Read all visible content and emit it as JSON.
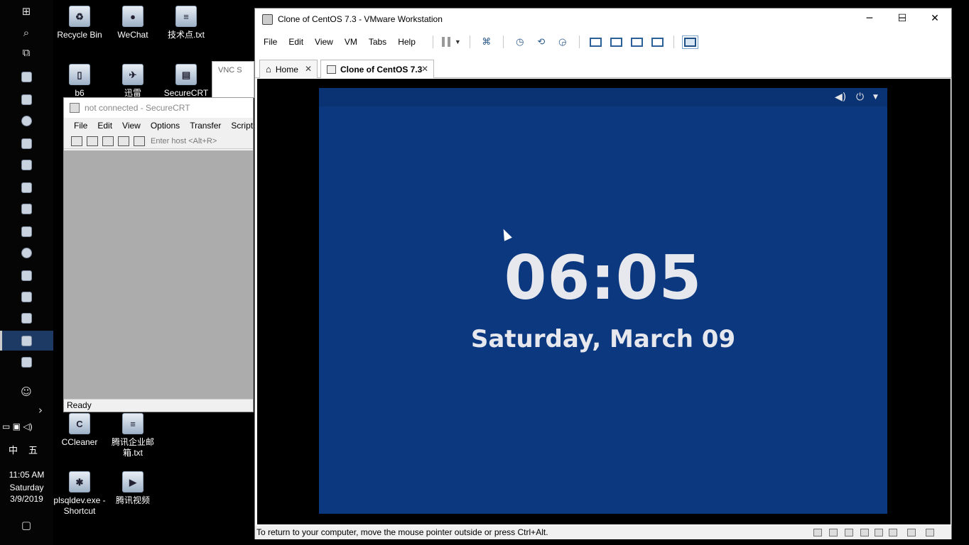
{
  "desktop": {
    "icons": [
      {
        "label": "Recycle Bin"
      },
      {
        "label": "WeChat"
      },
      {
        "label": "技术点.txt"
      },
      {
        "label": "b6"
      },
      {
        "label": "迅雷"
      },
      {
        "label": "SecureCRT"
      },
      {
        "label": "CCleaner"
      },
      {
        "label": "腾讯企业邮箱.txt"
      },
      {
        "label": "plsqldev.exe - Shortcut"
      },
      {
        "label": "腾讯视频"
      }
    ]
  },
  "taskbar": {
    "ime_lang": "中",
    "ime_mode": "五",
    "clock_time": "11:05 AM",
    "clock_day": "Saturday",
    "clock_date": "3/9/2019"
  },
  "securecrt": {
    "title": "not connected - SecureCRT",
    "menu": [
      "File",
      "Edit",
      "View",
      "Options",
      "Transfer",
      "Script"
    ],
    "enter_host": "Enter host <Alt+R>",
    "status": "Ready"
  },
  "vnc": {
    "title": "VNC S"
  },
  "vmware": {
    "title": "Clone of CentOS 7.3 - VMware Workstation",
    "menu": [
      "File",
      "Edit",
      "View",
      "VM",
      "Tabs",
      "Help"
    ],
    "tabs": [
      {
        "label": "Home",
        "active": false
      },
      {
        "label": "Clone of CentOS 7.3",
        "active": true
      }
    ],
    "status_text": "To return to your computer, move the mouse pointer outside or press Ctrl+Alt."
  },
  "guest": {
    "time": "06:05",
    "date": "Saturday, March 09",
    "background": "#0c3880"
  }
}
